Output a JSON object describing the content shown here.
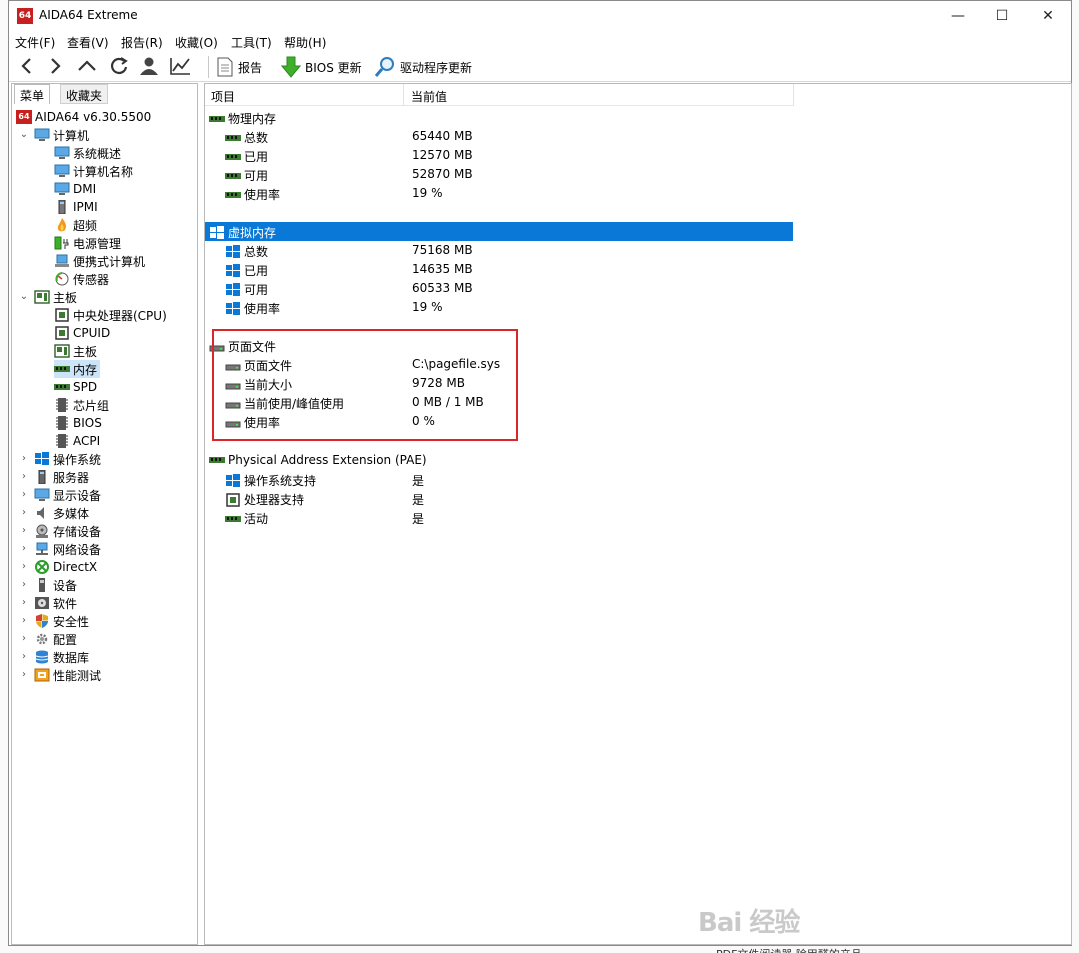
{
  "window": {
    "title": "AIDA64 Extreme",
    "app_icon_text": "64",
    "minimize": "—",
    "maximize": "☐",
    "close": "✕"
  },
  "menu": [
    "文件(F)",
    "查看(V)",
    "报告(R)",
    "收藏(O)",
    "工具(T)",
    "帮助(H)"
  ],
  "toolbar": {
    "report_label": "报告",
    "bios_label": "BIOS 更新",
    "driver_label": "驱动程序更新"
  },
  "left_panel": {
    "tabs": [
      "菜单",
      "收藏夹"
    ],
    "root_label": "AIDA64 v6.30.5500",
    "nodes": {
      "computer": "计算机",
      "summary": "系统概述",
      "computer_name": "计算机名称",
      "dmi": "DMI",
      "ipmi": "IPMI",
      "overclock": "超频",
      "power": "电源管理",
      "portable": "便携式计算机",
      "sensor": "传感器",
      "motherboard": "主板",
      "cpu": "中央处理器(CPU)",
      "cpuid": "CPUID",
      "mainboard": "主板",
      "memory": "内存",
      "spd": "SPD",
      "chipset": "芯片组",
      "bios": "BIOS",
      "acpi": "ACPI",
      "os": "操作系统",
      "server": "服务器",
      "display": "显示设备",
      "multimedia": "多媒体",
      "storage": "存储设备",
      "network": "网络设备",
      "directx": "DirectX",
      "devices": "设备",
      "software": "软件",
      "security": "安全性",
      "config": "配置",
      "database": "数据库",
      "benchmark": "性能测试"
    }
  },
  "table": {
    "col_item": "项目",
    "col_value": "当前值",
    "physical": {
      "title": "物理内存",
      "rows": [
        {
          "label": "总数",
          "value": "65440 MB"
        },
        {
          "label": "已用",
          "value": "12570 MB"
        },
        {
          "label": "可用",
          "value": "52870 MB"
        },
        {
          "label": "使用率",
          "value": "19 %"
        }
      ]
    },
    "virtual": {
      "title": "虚拟内存",
      "rows": [
        {
          "label": "总数",
          "value": "75168 MB"
        },
        {
          "label": "已用",
          "value": "14635 MB"
        },
        {
          "label": "可用",
          "value": "60533 MB"
        },
        {
          "label": "使用率",
          "value": "19 %"
        }
      ]
    },
    "pagefile": {
      "title": "页面文件",
      "rows": [
        {
          "label": "页面文件",
          "value": "C:\\pagefile.sys"
        },
        {
          "label": "当前大小",
          "value": "9728 MB"
        },
        {
          "label": "当前使用/峰值使用",
          "value": "0 MB / 1 MB"
        },
        {
          "label": "使用率",
          "value": "0 %"
        }
      ]
    },
    "pae": {
      "title": "Physical Address Extension (PAE)",
      "rows": [
        {
          "label": "操作系统支持",
          "value": "是"
        },
        {
          "label": "处理器支持",
          "value": "是"
        },
        {
          "label": "活动",
          "value": "是"
        }
      ]
    }
  },
  "watermark": "Bai 经验",
  "bottom_strip": "PDF文件阅读器    除甲醛的产品"
}
